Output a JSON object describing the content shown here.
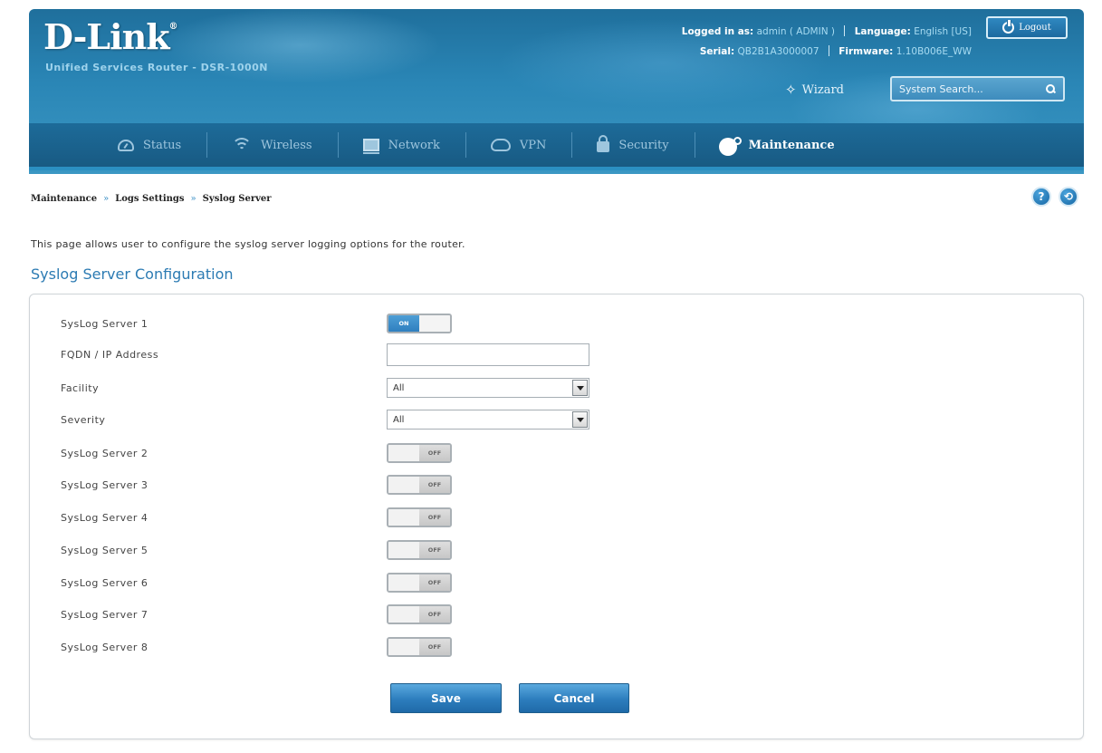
{
  "header": {
    "brand": "D-Link",
    "brand_mark": "®",
    "product": "Unified Services Router - DSR-1000N",
    "logged_in_label": "Logged in as:",
    "logged_in_value": "admin ( ADMIN )",
    "language_label": "Language:",
    "language_value": "English [US]",
    "serial_label": "Serial:",
    "serial_value": "QB2B1A3000007",
    "firmware_label": "Firmware:",
    "firmware_value": "1.10B006E_WW",
    "logout_label": "Logout",
    "wizard_label": "Wizard",
    "search_placeholder": "System Search..."
  },
  "nav": {
    "items": [
      {
        "label": "Status",
        "icon": "status-icon"
      },
      {
        "label": "Wireless",
        "icon": "wireless-icon"
      },
      {
        "label": "Network",
        "icon": "network-icon"
      },
      {
        "label": "VPN",
        "icon": "vpn-icon"
      },
      {
        "label": "Security",
        "icon": "security-icon"
      },
      {
        "label": "Maintenance",
        "icon": "gear-icon",
        "active": true
      }
    ]
  },
  "breadcrumb": [
    "Maintenance",
    "Logs Settings",
    "Syslog Server"
  ],
  "help": {
    "help_glyph": "?",
    "info_glyph": "⟲"
  },
  "page": {
    "description": "This page allows user to configure the syslog server logging options for the router.",
    "section_title": "Syslog Server Configuration"
  },
  "form": {
    "server1_label": "SysLog Server 1",
    "server1_state": "ON",
    "fqdn_label": "FQDN / IP Address",
    "fqdn_value": "",
    "facility_label": "Facility",
    "facility_value": "All",
    "severity_label": "Severity",
    "severity_value": "All",
    "servers": [
      {
        "label": "SysLog Server 2",
        "state": "OFF"
      },
      {
        "label": "SysLog Server 3",
        "state": "OFF"
      },
      {
        "label": "SysLog Server 4",
        "state": "OFF"
      },
      {
        "label": "SysLog Server 5",
        "state": "OFF"
      },
      {
        "label": "SysLog Server 6",
        "state": "OFF"
      },
      {
        "label": "SysLog Server 7",
        "state": "OFF"
      },
      {
        "label": "SysLog Server 8",
        "state": "OFF"
      }
    ]
  },
  "actions": {
    "save_label": "Save",
    "cancel_label": "Cancel"
  },
  "colors": {
    "header_blue": "#2a86b6",
    "nav_blue": "#185a83",
    "accent": "#2c7bb3"
  }
}
